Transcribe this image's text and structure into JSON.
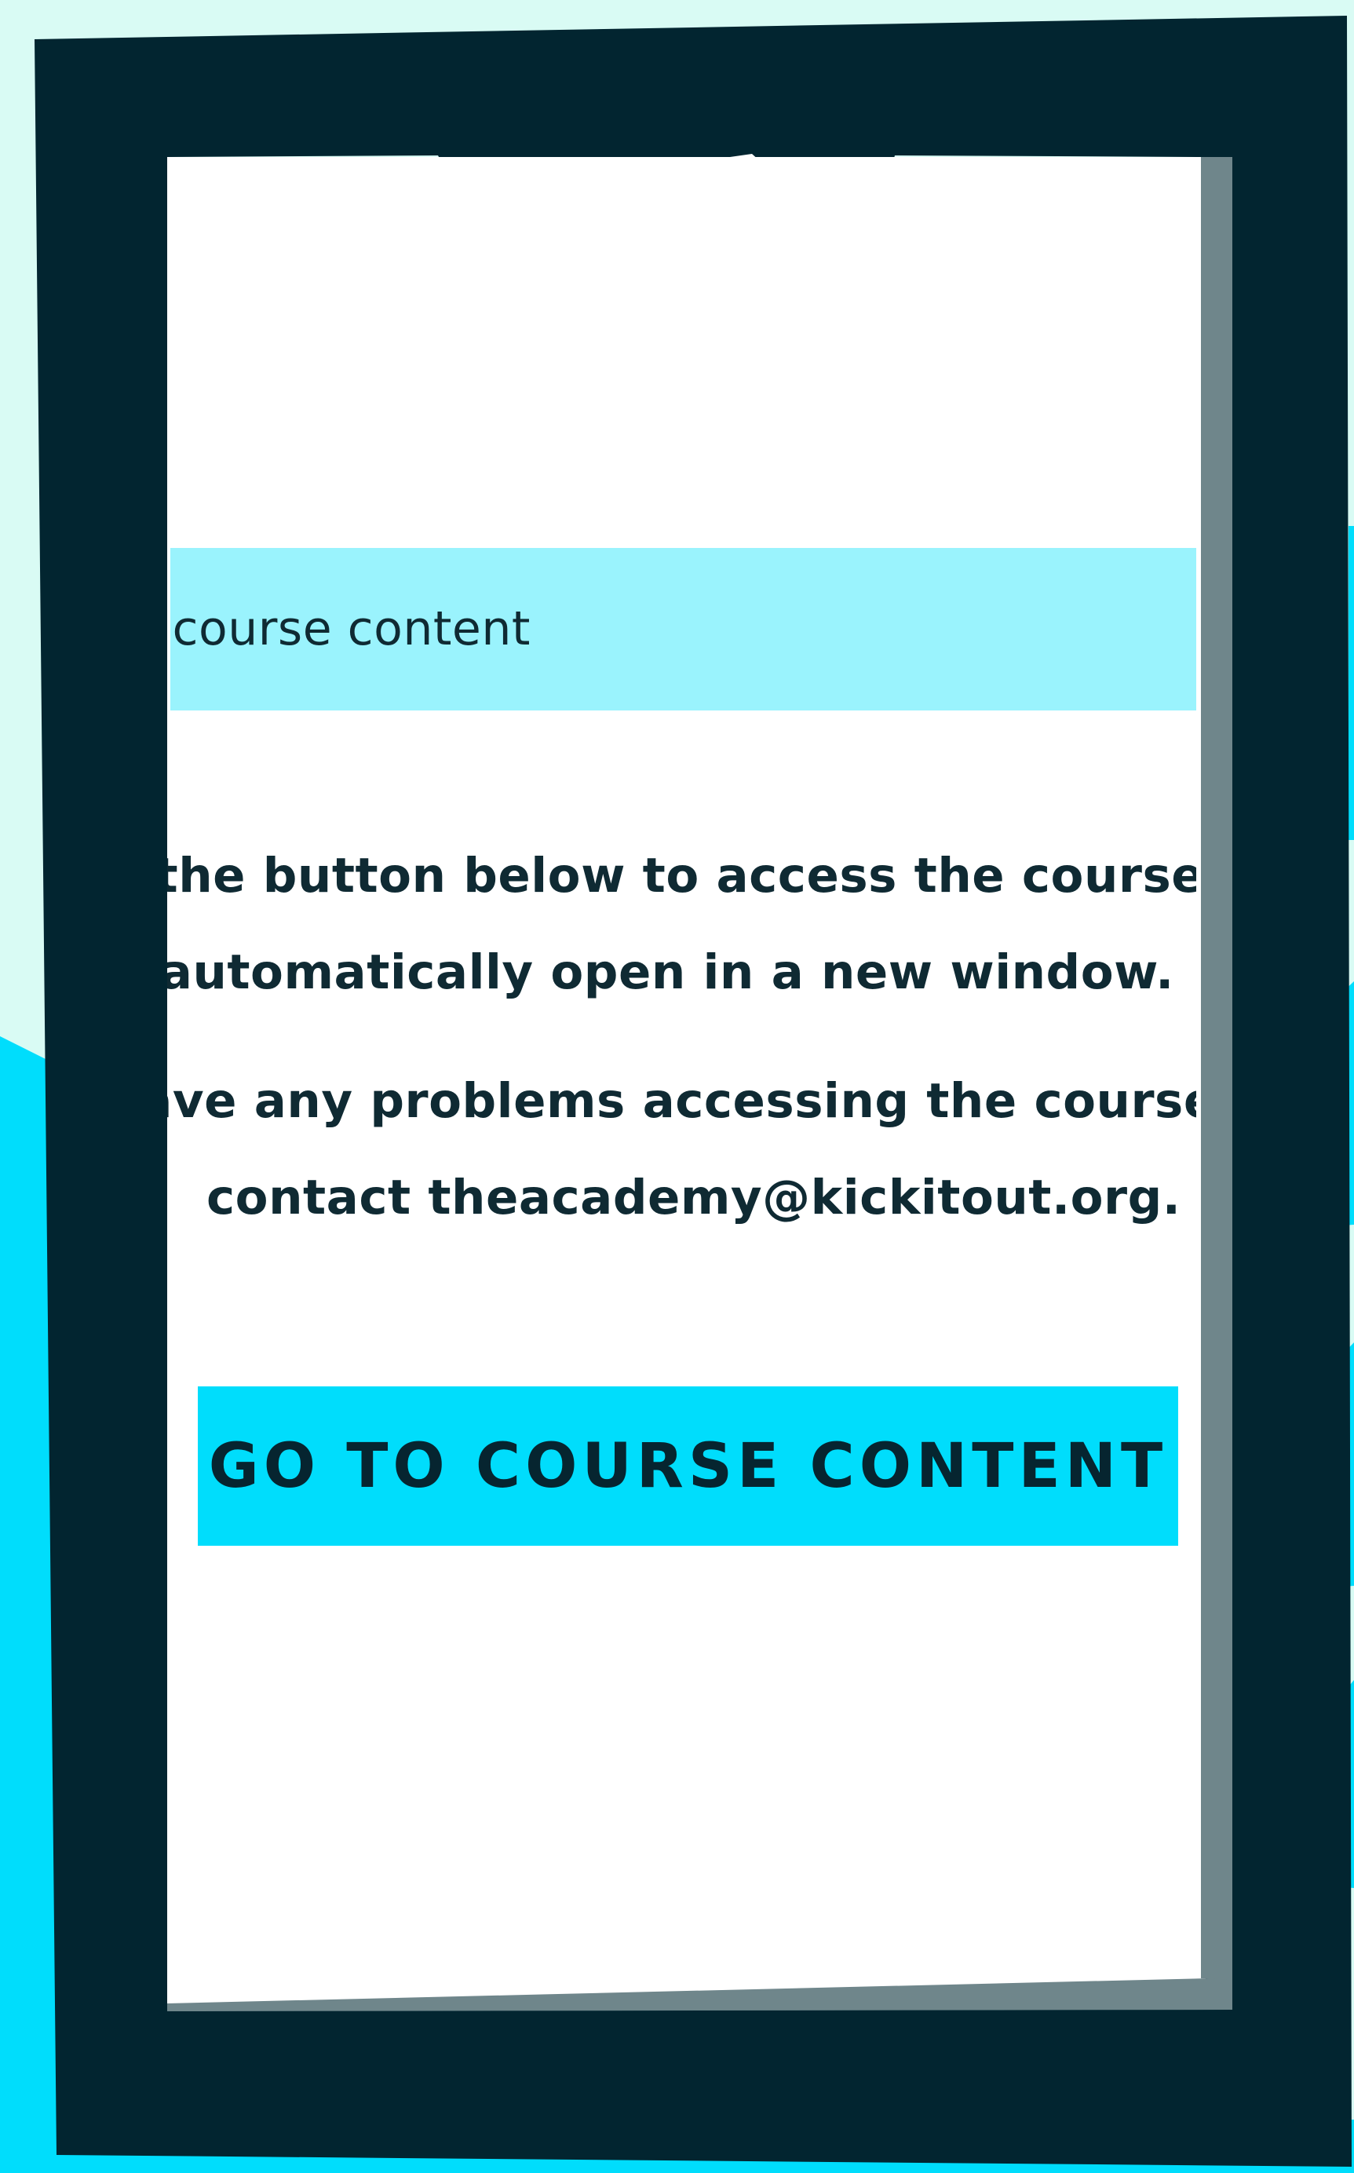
{
  "colors": {
    "background": "#d9fbf4",
    "accent": "#00ddfc",
    "banner": "#9af3fd",
    "frame": "#022530",
    "text": "#0f2a33"
  },
  "banner": {
    "text": "the course content"
  },
  "body": {
    "line1": "Click the button below to access the course content.",
    "line2": "This will automatically open in a new window.",
    "line3": "If you have any problems accessing the course content,",
    "line4": "contact theacademy@kickitout.org."
  },
  "cta": {
    "label": "GO TO COURSE CONTENT"
  },
  "icons": {
    "camera": "camera-dot-icon",
    "speaker": "speaker-slot-icon"
  }
}
